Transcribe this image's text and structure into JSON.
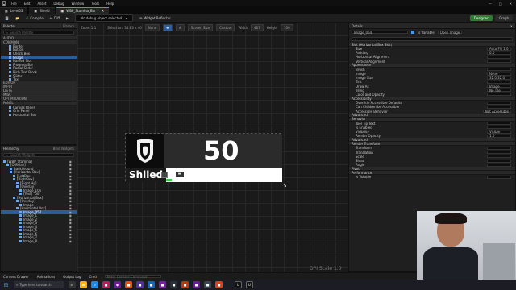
{
  "menu": {
    "items": [
      "File",
      "Edit",
      "Asset",
      "Debug",
      "Window",
      "Tools",
      "Help"
    ]
  },
  "tabs": [
    {
      "label": "Level03"
    },
    {
      "label": "Shield"
    },
    {
      "label": "WBP_Stamina_Bar",
      "active": true
    }
  ],
  "window": {
    "title": "WBP_Stamina_Bar"
  },
  "toolbar": {
    "compile": "Compile",
    "diff": "Diff",
    "debug_filter": "No debug object selected",
    "widget_reflector": "Widget Reflector",
    "designer": "Designer",
    "graph": "Graph"
  },
  "palette": {
    "title": "Palette",
    "library": "Library",
    "search_placeholder": "Search Palette",
    "categories": [
      "AUDIO",
      "COMMON"
    ],
    "common_items": [
      "Border",
      "Button",
      "Check Box",
      "Image",
      "Named Slot",
      "Progress Bar",
      "Radial Slider",
      "Rich Text Block",
      "Slider",
      "Text"
    ],
    "selected_item": "Image",
    "more_categories": [
      "EDITOR",
      "INPUT",
      "LISTS",
      "MISC",
      "OPTIMIZATION",
      "PANEL"
    ],
    "panel_items": [
      "Canvas Panel",
      "Grid Panel",
      "Horizontal Box"
    ]
  },
  "hierarchy": {
    "title": "Hierarchy",
    "bind": "Bind Widgets",
    "search_placeholder": "Search Widgets",
    "nodes": [
      {
        "label": "[WBP_Stamina]",
        "depth": 0
      },
      {
        "label": "[Overlay]",
        "depth": 1
      },
      {
        "label": "BackGround",
        "depth": 2
      },
      {
        "label": "[Horizontal Box]",
        "depth": 2
      },
      {
        "label": "[LeftBox]",
        "depth": 3
      },
      {
        "label": "[RightBox]",
        "depth": 3
      },
      {
        "label": "[Right Hp]",
        "depth": 4
      },
      {
        "label": "[Overlay]",
        "depth": 4
      },
      {
        "label": "Image_106",
        "depth": 5
      },
      {
        "label": "[Text] \"50\"",
        "depth": 5
      },
      {
        "label": "[Horizontal Box]",
        "depth": 3
      },
      {
        "label": "[Overlay]",
        "depth": 4
      },
      {
        "label": "Image",
        "depth": 5
      },
      {
        "label": "[Horizontal Box]",
        "depth": 4
      },
      {
        "label": "Image_054",
        "depth": 5,
        "selected": true
      },
      {
        "label": "Image_1",
        "depth": 5
      },
      {
        "label": "Image_2",
        "depth": 5
      },
      {
        "label": "Image_3",
        "depth": 5
      },
      {
        "label": "Image_4",
        "depth": 5
      },
      {
        "label": "Image_5",
        "depth": 5
      },
      {
        "label": "Image_6",
        "depth": 5
      },
      {
        "label": "Image_7",
        "depth": 5
      },
      {
        "label": "Image_8",
        "depth": 5
      }
    ]
  },
  "viewport": {
    "zoom": "Zoom 1:1",
    "selection": "Selection: 35.83 x 40",
    "none": "None",
    "screen_size": "Screen Size",
    "custom": "Custom",
    "width_label": "Width",
    "width": "467",
    "height_label": "Height",
    "height": "100",
    "dpi": "DPI Scale 1.0",
    "widget": {
      "number": "50",
      "label": "Shiled",
      "stamina_fraction": 0.05
    }
  },
  "details": {
    "title": "Details",
    "name": "Image_054",
    "is_variable": "Is Variable",
    "open_image": "Open Image",
    "sections": [
      {
        "header": "Slot (Horizontal Box Slot)",
        "props": [
          [
            "Size",
            "Auto  Fill  1.0"
          ],
          [
            "Padding",
            "0.0"
          ],
          [
            "Horizontal Alignment",
            ""
          ],
          [
            "Vertical Alignment",
            ""
          ]
        ]
      },
      {
        "header": "Appearance",
        "props": [
          [
            "Brush",
            ""
          ],
          [
            "Image",
            "None"
          ],
          [
            "Image Size",
            "32.0   32.0"
          ],
          [
            "Tint",
            ""
          ],
          [
            "Draw As",
            "Image"
          ],
          [
            "Tiling",
            "No Tile"
          ],
          [
            "Color and Opacity",
            ""
          ]
        ]
      },
      {
        "header": "Accessibility",
        "props": [
          [
            "Override Accessible Defaults",
            ""
          ],
          [
            "Can Children be Accessible",
            ""
          ],
          [
            "Accessible Behavior",
            "Not Accessible"
          ]
        ]
      },
      {
        "header": "Advanced",
        "props": []
      },
      {
        "header": "Behavior",
        "props": [
          [
            "Tool Tip Text",
            ""
          ],
          [
            "Is Enabled",
            ""
          ],
          [
            "Visibility",
            "Visible"
          ],
          [
            "Render Opacity",
            "1.0"
          ]
        ]
      },
      {
        "header": "Advanced",
        "props": []
      },
      {
        "header": "Render Transform",
        "props": [
          [
            "Transform",
            ""
          ],
          [
            "Translation",
            ""
          ],
          [
            "Scale",
            ""
          ],
          [
            "Shear",
            ""
          ],
          [
            "Angle",
            ""
          ]
        ]
      },
      {
        "header": "Pivot",
        "props": []
      },
      {
        "header": "Performance",
        "props": [
          [
            "Is Volatile",
            ""
          ]
        ]
      }
    ],
    "bind": "Bind"
  },
  "statusbar": {
    "content_drawer": "Content Drawer",
    "animations": "Animations",
    "output_log": "Output Log",
    "cmd": "Cmd",
    "console_placeholder": "Enter Console Command"
  },
  "taskbar": {
    "search": "Type here to search"
  },
  "colors": {
    "accent": "#3a9bff",
    "selected": "#2b5d9e",
    "designer": "#2f7d32",
    "stamina": "#3cd13c"
  }
}
